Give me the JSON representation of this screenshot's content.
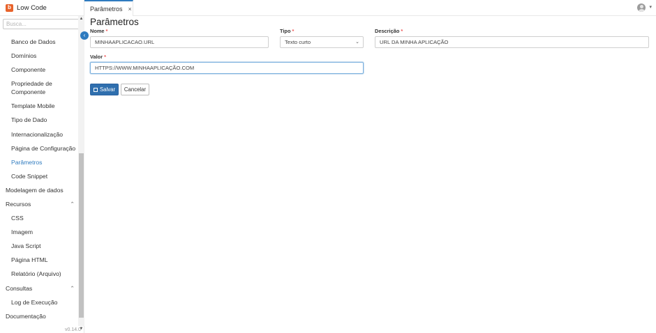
{
  "app": {
    "name": "Low Code",
    "logo_letter": "b",
    "version": "v0.14.0"
  },
  "sidebar": {
    "search_placeholder": "Busca...",
    "items": [
      {
        "label": "Banco de Dados",
        "kind": "child"
      },
      {
        "label": "Domínios",
        "kind": "child"
      },
      {
        "label": "Componente",
        "kind": "child"
      },
      {
        "label": "Propriedade de Componente",
        "kind": "child-2line"
      },
      {
        "label": "Template Mobile",
        "kind": "child"
      },
      {
        "label": "Tipo de Dado",
        "kind": "child"
      },
      {
        "label": "Internacionalização",
        "kind": "child"
      },
      {
        "label": "Página de Configuração",
        "kind": "child"
      },
      {
        "label": "Parâmetros",
        "kind": "child",
        "active": true
      },
      {
        "label": "Code Snippet",
        "kind": "child"
      },
      {
        "label": "Modelagem de dados",
        "kind": "group"
      },
      {
        "label": "Recursos",
        "kind": "group",
        "expanded": true
      },
      {
        "label": "CSS",
        "kind": "child"
      },
      {
        "label": "Imagem",
        "kind": "child"
      },
      {
        "label": "Java Script",
        "kind": "child"
      },
      {
        "label": "Página HTML",
        "kind": "child"
      },
      {
        "label": "Relatório (Arquivo)",
        "kind": "child"
      },
      {
        "label": "Consultas",
        "kind": "group",
        "expanded": true
      },
      {
        "label": "Log de Execução",
        "kind": "child"
      },
      {
        "label": "Documentação",
        "kind": "group"
      }
    ]
  },
  "header": {
    "tab_label": "Parâmetros",
    "tab_close": "×"
  },
  "main": {
    "title": "Parâmetros",
    "fields": {
      "nome": {
        "label": "Nome",
        "required_mark": "*",
        "value": "MINHAAPLICACAO.URL"
      },
      "tipo": {
        "label": "Tipo",
        "required_mark": "*",
        "value": "Texto curto"
      },
      "descricao": {
        "label": "Descrição",
        "required_mark": "*",
        "value": "URL DA MINHA APLICAÇÃO"
      },
      "valor": {
        "label": "Valor",
        "required_mark": "*",
        "value": "HTTPS://WWW.MINHAAPLICAÇÃO.COM"
      }
    },
    "buttons": {
      "save": "Salvar",
      "cancel": "Cancelar"
    }
  },
  "colors": {
    "accent": "#2f7bbf",
    "save_button": "#2f6fae",
    "logo": "#e8632b",
    "required": "#e55555"
  },
  "icons": [
    "logo-icon",
    "collapse-chevron-icon",
    "close-icon",
    "user-avatar-icon",
    "chevron-up-icon",
    "chevron-down-icon",
    "save-disk-icon"
  ]
}
